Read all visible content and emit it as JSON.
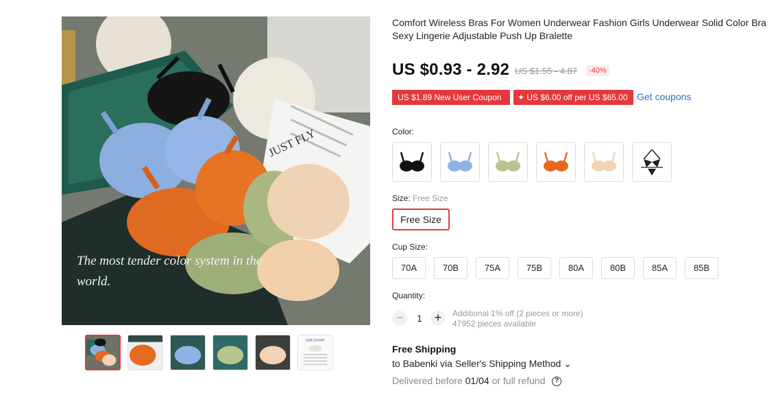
{
  "product": {
    "title": "Comfort Wireless Bras For Women Underwear Fashion Girls Underwear Solid Color Bra Sexy Lingerie Adjustable Push Up Bralette",
    "image_caption_line1": "The most tender color system in the",
    "image_caption_line2": "world.",
    "image_card_text": "JUST FLY"
  },
  "thumbnails": [
    {
      "name": "mixed"
    },
    {
      "name": "orange"
    },
    {
      "name": "blue"
    },
    {
      "name": "green"
    },
    {
      "name": "beige"
    },
    {
      "name": "size-chart",
      "label": "SIZE CHART"
    }
  ],
  "price": {
    "current": "US $0.93 - 2.92",
    "original": "US $1.55 - 4.87",
    "discount": "-40%"
  },
  "coupons": {
    "new_user": "US $1.89 New User Coupon",
    "store": "✦ US $6.00 off per US $65.00",
    "get_link": "Get coupons"
  },
  "color": {
    "label": "Color:",
    "options": [
      {
        "name": "black",
        "hex": "#111111"
      },
      {
        "name": "blue",
        "hex": "#8fb2e4"
      },
      {
        "name": "green",
        "hex": "#b8c48e"
      },
      {
        "name": "orange",
        "hex": "#e56a1e"
      },
      {
        "name": "beige",
        "hex": "#f3d3b6"
      },
      {
        "name": "halter-black",
        "hex": "#222222"
      }
    ]
  },
  "size": {
    "label": "Size:",
    "selected_value": "Free Size",
    "options": [
      "Free Size"
    ]
  },
  "cup": {
    "label": "Cup Size:",
    "options": [
      "70A",
      "70B",
      "75A",
      "75B",
      "80A",
      "80B",
      "85A",
      "85B"
    ]
  },
  "quantity": {
    "label": "Quantity:",
    "minus": "−",
    "value": "1",
    "plus": "+",
    "note_line1": "Additional 1% off (2 pieces or more)",
    "note_line2": "47952 pieces available"
  },
  "shipping": {
    "title": "Free Shipping",
    "to": "to Babenki via Seller's Shipping Method ⌄",
    "delivered_prefix": "Delivered before",
    "date": "01/04",
    "suffix": "or full refund",
    "help": "?"
  },
  "colors": {
    "accent": "#e4393c",
    "link": "#2a6ebf"
  }
}
